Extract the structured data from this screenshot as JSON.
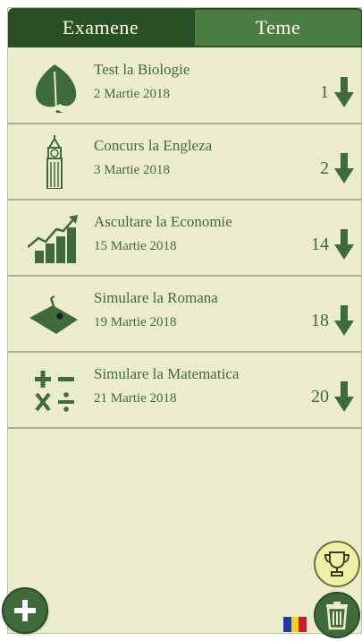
{
  "tabs": [
    {
      "label": "Examene",
      "active": true
    },
    {
      "label": "Teme",
      "active": false
    }
  ],
  "exams": [
    {
      "icon": "leaf-icon",
      "title": "Test la Biologie",
      "date": "2 Martie 2018",
      "count": "1"
    },
    {
      "icon": "big-ben-icon",
      "title": "Concurs la Engleza",
      "date": "3 Martie 2018",
      "count": "2"
    },
    {
      "icon": "growth-chart-icon",
      "title": "Ascultare la Economie",
      "date": "15 Martie 2018",
      "count": "14"
    },
    {
      "icon": "map-pin-icon",
      "title": "Simulare la Romana",
      "date": "19 Martie 2018",
      "count": "18"
    },
    {
      "icon": "math-operators-icon",
      "title": "Simulare la Matematica",
      "date": "21 Martie 2018",
      "count": "20"
    }
  ],
  "actions": {
    "add": "plus-icon",
    "trophy": "trophy-icon",
    "trash": "trash-icon",
    "language": "romania-flag-icon"
  },
  "colors": {
    "background": "#ebeccc",
    "dark_green": "#294f24",
    "mid_green": "#4c7d45",
    "text_green": "#3f6b3a",
    "trophy_bg": "#eef0a8"
  }
}
